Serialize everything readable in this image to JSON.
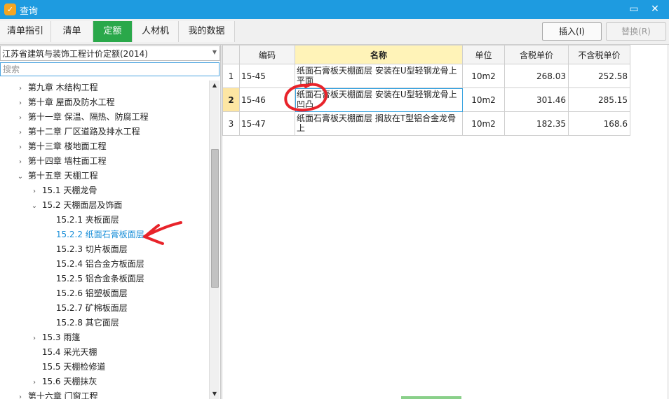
{
  "window": {
    "title": "查询",
    "app_icon": "app-logo-icon",
    "accent": "#1e9be0"
  },
  "toolbar": {
    "tabs": [
      {
        "label": "清单指引"
      },
      {
        "label": "清单"
      },
      {
        "label": "定额",
        "active": true
      },
      {
        "label": "人材机"
      },
      {
        "label": "我的数据"
      }
    ],
    "insert_label": "插入(I)",
    "replace_label": "替换(R)",
    "active_color": "#2aa84a"
  },
  "left": {
    "quota_library": "江苏省建筑与装饰工程计价定额(2014)",
    "search_placeholder": "搜索",
    "tree": [
      {
        "label": "第九章 木结构工程",
        "toggle": "›"
      },
      {
        "label": "第十章 屋面及防水工程",
        "toggle": "›"
      },
      {
        "label": "第十一章 保温、隔热、防腐工程",
        "toggle": "›"
      },
      {
        "label": "第十二章 厂区道路及排水工程",
        "toggle": "›"
      },
      {
        "label": "第十三章 楼地面工程",
        "toggle": "›"
      },
      {
        "label": "第十四章 墙柱面工程",
        "toggle": "›"
      },
      {
        "label": "第十五章 天棚工程",
        "toggle": "⌄"
      },
      {
        "label": "15.1 天棚龙骨",
        "toggle": "›"
      },
      {
        "label": "15.2 天棚面层及饰面",
        "toggle": "⌄"
      },
      {
        "label": "15.2.1 夹板面层",
        "toggle": ""
      },
      {
        "label": "15.2.2 纸面石膏板面层",
        "toggle": "",
        "selected": true
      },
      {
        "label": "15.2.3 切片板面层",
        "toggle": ""
      },
      {
        "label": "15.2.4 铝合金方板面层",
        "toggle": ""
      },
      {
        "label": "15.2.5 铝合金条板面层",
        "toggle": ""
      },
      {
        "label": "15.2.6 铝塑板面层",
        "toggle": ""
      },
      {
        "label": "15.2.7 矿棉板面层",
        "toggle": ""
      },
      {
        "label": "15.2.8 其它面层",
        "toggle": ""
      },
      {
        "label": "15.3 雨篷",
        "toggle": "›"
      },
      {
        "label": "15.4 采光天棚",
        "toggle": ""
      },
      {
        "label": "15.5 天棚检修道",
        "toggle": ""
      },
      {
        "label": "15.6 天棚抹灰",
        "toggle": "›"
      },
      {
        "label": "第十六章 门窗工程",
        "toggle": "›"
      }
    ]
  },
  "grid": {
    "headers": {
      "code": "编码",
      "name": "名称",
      "unit": "单位",
      "price_tax": "含税单价",
      "price_notax": "不含税单价"
    },
    "rows": [
      {
        "no": "1",
        "code": "15-45",
        "name": "纸面石膏板天棚面层 安装在U型轻钢龙骨上 平面",
        "unit": "10m2",
        "price_tax": "268.03",
        "price_notax": "252.58"
      },
      {
        "no": "2",
        "code": "15-46",
        "name": "纸面石膏板天棚面层 安装在U型轻钢龙骨上 凹凸",
        "unit": "10m2",
        "price_tax": "301.46",
        "price_notax": "285.15"
      },
      {
        "no": "3",
        "code": "15-47",
        "name": "纸面石膏板天棚面层 搁放在T型铝合金龙骨 上",
        "unit": "10m2",
        "price_tax": "182.35",
        "price_notax": "168.6"
      }
    ]
  }
}
